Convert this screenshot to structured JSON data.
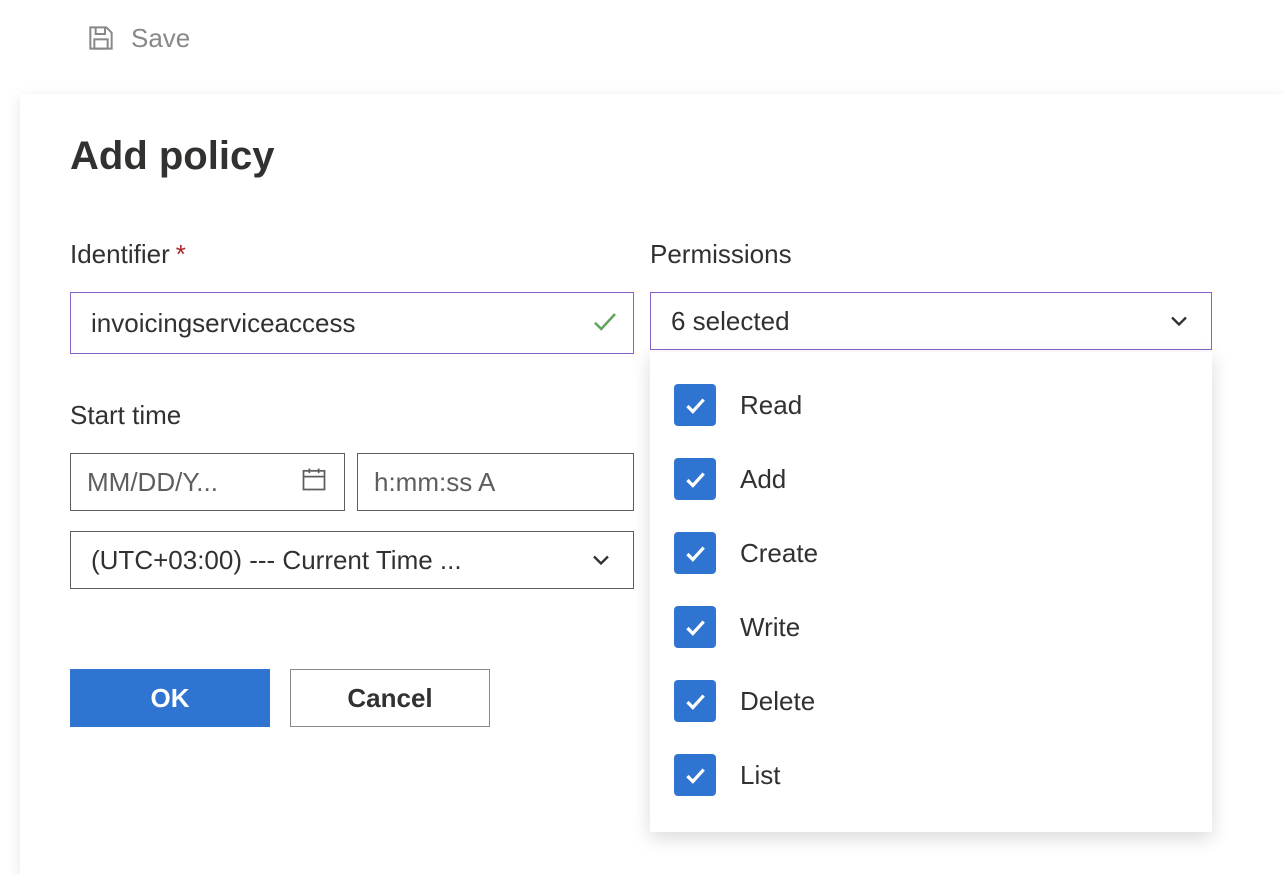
{
  "toolbar": {
    "save_label": "Save"
  },
  "panel": {
    "title": "Add policy",
    "identifier_label": "Identifier",
    "identifier_value": "invoicingserviceaccess",
    "required_mark": "*",
    "start_time_label": "Start time",
    "date_placeholder": "MM/DD/Y...",
    "time_placeholder": "h:mm:ss A",
    "timezone_value": "(UTC+03:00) --- Current Time ...",
    "ok_label": "OK",
    "cancel_label": "Cancel"
  },
  "permissions": {
    "label": "Permissions",
    "summary": "6 selected",
    "options": [
      {
        "label": "Read",
        "checked": true
      },
      {
        "label": "Add",
        "checked": true
      },
      {
        "label": "Create",
        "checked": true
      },
      {
        "label": "Write",
        "checked": true
      },
      {
        "label": "Delete",
        "checked": true
      },
      {
        "label": "List",
        "checked": true
      }
    ]
  },
  "background": {
    "add_policy_label": "Add policy"
  }
}
